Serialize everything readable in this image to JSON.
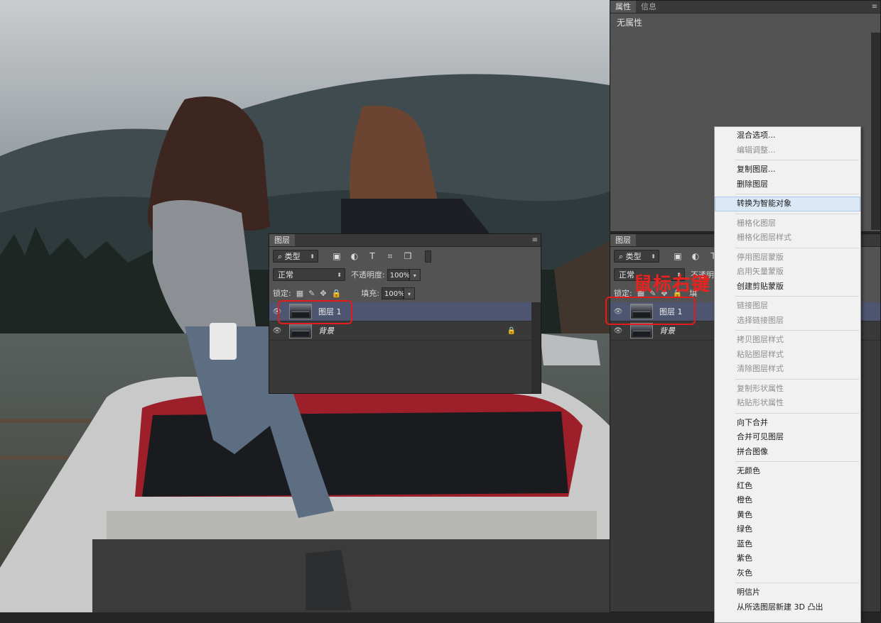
{
  "properties_panel": {
    "tabs": [
      "属性",
      "信息"
    ],
    "menu_icon": "≡",
    "content": "无属性"
  },
  "layers_panel_left": {
    "tab": "图层",
    "menu_icon": "≡",
    "filter_label": "类型",
    "blend_mode": "正常",
    "opacity_label": "不透明度:",
    "opacity_value": "100%",
    "lock_label": "锁定:",
    "fill_label": "填充:",
    "fill_value": "100%",
    "layers": [
      {
        "name": "图层 1",
        "selected": true,
        "locked": false,
        "italic": false
      },
      {
        "name": "背景",
        "selected": false,
        "locked": true,
        "italic": true
      }
    ]
  },
  "layers_panel_right": {
    "tab": "图层",
    "filter_label": "类型",
    "blend_mode": "正常",
    "opacity_label": "不透明",
    "lock_label": "锁定:",
    "fill_label_partial": "填",
    "layers": [
      {
        "name": "图层 1",
        "selected": true
      },
      {
        "name": "背景",
        "selected": false,
        "italic": true
      }
    ]
  },
  "annotation_text": "鼠标右键",
  "context_menu": {
    "items": [
      {
        "label": "混合选项...",
        "disabled": false
      },
      {
        "label": "编辑调整...",
        "disabled": true
      },
      {
        "sep": true
      },
      {
        "label": "复制图层...",
        "disabled": false
      },
      {
        "label": "删除图层",
        "disabled": false
      },
      {
        "sep": true
      },
      {
        "label": "转换为智能对象",
        "disabled": false,
        "hover": true
      },
      {
        "sep": true
      },
      {
        "label": "栅格化图层",
        "disabled": true
      },
      {
        "label": "栅格化图层样式",
        "disabled": true
      },
      {
        "sep": true
      },
      {
        "label": "停用图层蒙版",
        "disabled": true
      },
      {
        "label": "启用矢量蒙版",
        "disabled": true
      },
      {
        "label": "创建剪贴蒙版",
        "disabled": false
      },
      {
        "sep": true
      },
      {
        "label": "链接图层",
        "disabled": true
      },
      {
        "label": "选择链接图层",
        "disabled": true
      },
      {
        "sep": true
      },
      {
        "label": "拷贝图层样式",
        "disabled": true
      },
      {
        "label": "粘贴图层样式",
        "disabled": true
      },
      {
        "label": "清除图层样式",
        "disabled": true
      },
      {
        "sep": true
      },
      {
        "label": "复制形状属性",
        "disabled": true
      },
      {
        "label": "粘贴形状属性",
        "disabled": true
      },
      {
        "sep": true
      },
      {
        "label": "向下合并",
        "disabled": false
      },
      {
        "label": "合并可见图层",
        "disabled": false
      },
      {
        "label": "拼合图像",
        "disabled": false
      },
      {
        "sep": true
      },
      {
        "label": "无颜色",
        "disabled": false
      },
      {
        "label": "红色",
        "disabled": false
      },
      {
        "label": "橙色",
        "disabled": false
      },
      {
        "label": "黄色",
        "disabled": false
      },
      {
        "label": "绿色",
        "disabled": false
      },
      {
        "label": "蓝色",
        "disabled": false
      },
      {
        "label": "紫色",
        "disabled": false
      },
      {
        "label": "灰色",
        "disabled": false
      },
      {
        "sep": true
      },
      {
        "label": "明信片",
        "disabled": false
      },
      {
        "label": "从所选图层新建 3D 凸出",
        "disabled": false
      }
    ]
  },
  "colors": {
    "panel": "#535353",
    "panel_dark": "#393939",
    "selected_layer": "#4e5570",
    "annotation": "#e21c1c",
    "menu_bg": "#f1f1f1"
  }
}
